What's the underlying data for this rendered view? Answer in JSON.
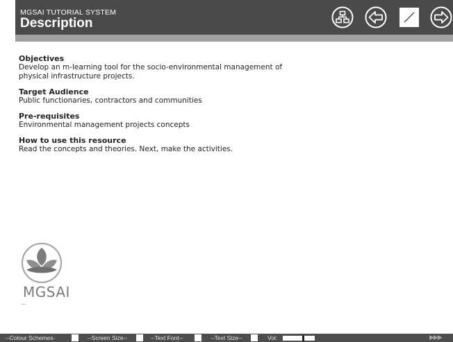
{
  "header": {
    "system_name": "MGSAI TUTORIAL SYSTEM",
    "page_title": "Description"
  },
  "nav": {
    "icons": [
      "sitemap-icon",
      "back-arrow-icon",
      "pen-icon",
      "next-arrow-icon"
    ]
  },
  "sections": [
    {
      "heading": "Objectives",
      "body": "Develop an m-learning tool for the socio-environmental management of\nphysical infrastructure projects."
    },
    {
      "heading": "Target Audience",
      "body": "Public functionaries, contractors and communities"
    },
    {
      "heading": "Pre-requisites",
      "body": "Environmental  management projects concepts"
    },
    {
      "heading": "How to use this resource",
      "body": "Read the concepts and theories. Next, make the activities."
    }
  ],
  "logo": {
    "text": "MGSAI"
  },
  "toolbar": {
    "colour_schemes": "--Colour Schemes-",
    "screen_size": "--Screen Size--",
    "text_font": "--Text Font--",
    "text_size": "--Text Size--",
    "vol_label": "Vol:",
    "volume_level": 0.65,
    "more_arrows": "▶▶▶"
  },
  "colors": {
    "header_bg": "#4a4a4a",
    "header_strip": "#a0a0a0",
    "toolbar_bg": "#4d4d4d"
  }
}
